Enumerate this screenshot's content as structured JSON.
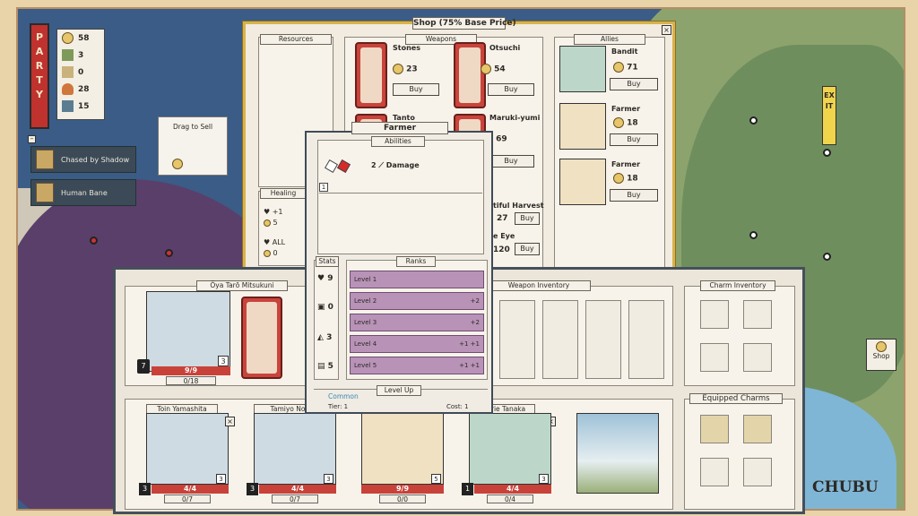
{
  "party": {
    "label": "PARTY",
    "resources": [
      {
        "icon": "coin-icon",
        "value": "58",
        "color": "#e2c25e"
      },
      {
        "icon": "bamboo-icon",
        "value": "3",
        "color": "#7d9a5b"
      },
      {
        "icon": "rice-icon",
        "value": "0",
        "color": "#c9b27c"
      },
      {
        "icon": "fire-icon",
        "value": "28",
        "color": "#d0773d"
      },
      {
        "icon": "tools-icon",
        "value": "15",
        "color": "#5b7d92"
      }
    ],
    "statuses": [
      "Chased by Shadow",
      "Human Bane"
    ],
    "drag_to_sell": "Drag to Sell"
  },
  "shop": {
    "title": "Shop (75% Base Price)",
    "sections": {
      "resources": "Resources",
      "weapons": "Weapons",
      "allies": "Allies",
      "healing": "Healing"
    },
    "weapons": [
      {
        "name": "Stones",
        "price": "23",
        "buy": "Buy"
      },
      {
        "name": "Otsuchi",
        "price": "54",
        "buy": "Buy"
      },
      {
        "name": "Tanto",
        "price": "",
        "buy": "Buy"
      },
      {
        "name": "Maruki-yumi",
        "price": "69",
        "buy": "Buy"
      }
    ],
    "allies": [
      {
        "name": "Bandit",
        "price": "71",
        "buy": "Buy"
      },
      {
        "name": "Farmer",
        "price": "18",
        "buy": "Buy"
      },
      {
        "name": "Farmer",
        "price": "18",
        "buy": "Buy"
      }
    ],
    "healing": [
      {
        "amount": "+1",
        "cost": "5"
      },
      {
        "amount": "ALL",
        "cost": "0"
      }
    ],
    "charms": [
      {
        "name": "tiful Harvest",
        "price": "27",
        "buy": "Buy"
      },
      {
        "name": "e Eye",
        "price": "120",
        "buy": "Buy"
      }
    ]
  },
  "tooltip": {
    "title": "Farmer",
    "abilities_label": "Abilities",
    "ability": {
      "count": "2",
      "name": "Damage",
      "level": "1"
    },
    "stats_label": "Stats",
    "ranks_label": "Ranks",
    "stats": [
      "9",
      "0",
      "3",
      "5"
    ],
    "ranks": [
      {
        "label": "Level 1",
        "bonus": ""
      },
      {
        "label": "Level 2",
        "bonus": "+2"
      },
      {
        "label": "Level 3",
        "bonus": "+2"
      },
      {
        "label": "Level 4",
        "bonus": "+1  +1"
      },
      {
        "label": "Level 5",
        "bonus": "+1  +1"
      }
    ],
    "rarity": "Common",
    "tier": "Tier: 1",
    "level_up": "Level Up",
    "cost": "Cost: 1"
  },
  "inventory": {
    "leader_name": "Ōya Tarō Mitsukuni",
    "leader_hp": "9/9",
    "leader_xp": "0/18",
    "leader_level": "7",
    "leader_slots": "3",
    "weapon_inventory": "Weapon Inventory",
    "charm_inventory": "Charm Inventory",
    "equipped_charms": "Equipped Charms",
    "members": [
      {
        "name": "Toin Yamashita",
        "hp": "4/4",
        "xp": "0/7",
        "level": "3",
        "slots": "3"
      },
      {
        "name": "Tamiyo No",
        "hp": "4/4",
        "xp": "0/7",
        "level": "3",
        "slots": "3"
      },
      {
        "name": "",
        "hp": "9/9",
        "xp": "0/0",
        "level": "",
        "slots": "5"
      },
      {
        "name": "rie Tanaka",
        "hp": "4/4",
        "xp": "0/4",
        "level": "1",
        "slots": "3"
      }
    ]
  },
  "map": {
    "region": "CHUBU",
    "exit": "EXIT",
    "shop": "Shop"
  },
  "colors": {
    "accent_red": "#c0322d",
    "panel_dark": "#3f4b57",
    "gold": "#d9b34a",
    "rank_purple": "#b892b7"
  }
}
